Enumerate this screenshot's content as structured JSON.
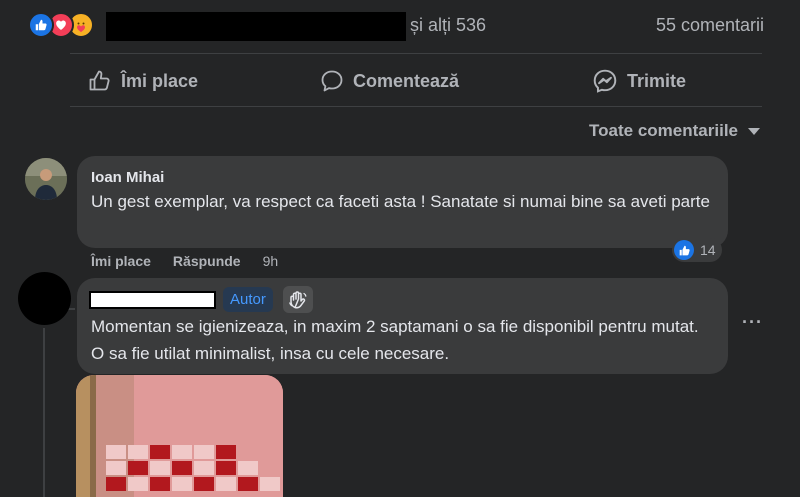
{
  "post_stats": {
    "reactions": [
      "like-icon",
      "love-icon",
      "care-icon"
    ],
    "others_text": "și alți 536",
    "comments_count": "55 comentarii"
  },
  "actions": {
    "like": "Îmi place",
    "comment": "Comentează",
    "share": "Trimite"
  },
  "sort": {
    "label": "Toate comentariile"
  },
  "comments": [
    {
      "author": "Ioan Mihai",
      "text": "Un gest exemplar, va respect ca faceti asta ! Sanatate si numai bine sa aveti parte",
      "like_label": "Îmi place",
      "reply_label": "Răspunde",
      "time": "9h",
      "reaction_count": "14"
    },
    {
      "badge": "Autor",
      "text": "Momentan se igienizeaza, in maxim 2 saptamani o sa fie disponibil pentru mutat. O sa fie utilat minimalist, insa cu cele necesare.",
      "more": "···"
    }
  ],
  "colors": {
    "background": "#242526",
    "bubble": "#3a3b3c",
    "accent": "#1b74e4",
    "author_badge_text": "#4599ff"
  }
}
